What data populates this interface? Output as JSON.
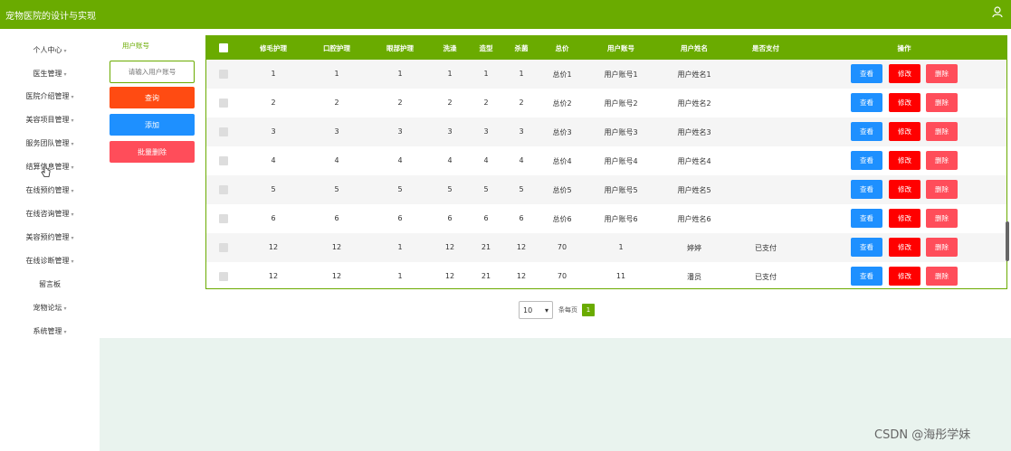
{
  "app": {
    "title": "宠物医院的设计与实现"
  },
  "sidebar": {
    "items": [
      {
        "label": "个人中心"
      },
      {
        "label": "医生管理"
      },
      {
        "label": "医院介绍管理"
      },
      {
        "label": "美容项目管理"
      },
      {
        "label": "服务团队管理"
      },
      {
        "label": "结算信息管理"
      },
      {
        "label": "在线预约管理"
      },
      {
        "label": "在线咨询管理"
      },
      {
        "label": "美容预约管理"
      },
      {
        "label": "在线诊断管理"
      },
      {
        "label": "留言板"
      },
      {
        "label": "宠物论坛"
      },
      {
        "label": "系统管理"
      }
    ]
  },
  "search": {
    "label": "用户账号",
    "placeholder": "请输入用户账号",
    "query_label": "查询",
    "add_label": "添加",
    "batch_delete_label": "批量删除"
  },
  "table": {
    "columns": [
      "修毛护理",
      "口腔护理",
      "眼部护理",
      "洗澡",
      "造型",
      "杀菌",
      "总价",
      "用户账号",
      "用户姓名",
      "是否支付",
      "操作"
    ],
    "rows": [
      {
        "cells": [
          "1",
          "1",
          "1",
          "1",
          "1",
          "1",
          "总价1",
          "用户账号1",
          "用户姓名1",
          ""
        ]
      },
      {
        "cells": [
          "2",
          "2",
          "2",
          "2",
          "2",
          "2",
          "总价2",
          "用户账号2",
          "用户姓名2",
          ""
        ]
      },
      {
        "cells": [
          "3",
          "3",
          "3",
          "3",
          "3",
          "3",
          "总价3",
          "用户账号3",
          "用户姓名3",
          ""
        ]
      },
      {
        "cells": [
          "4",
          "4",
          "4",
          "4",
          "4",
          "4",
          "总价4",
          "用户账号4",
          "用户姓名4",
          ""
        ]
      },
      {
        "cells": [
          "5",
          "5",
          "5",
          "5",
          "5",
          "5",
          "总价5",
          "用户账号5",
          "用户姓名5",
          ""
        ]
      },
      {
        "cells": [
          "6",
          "6",
          "6",
          "6",
          "6",
          "6",
          "总价6",
          "用户账号6",
          "用户姓名6",
          ""
        ]
      },
      {
        "cells": [
          "12",
          "12",
          "1",
          "12",
          "21",
          "12",
          "70",
          "1",
          "婷婷",
          "已支付"
        ]
      },
      {
        "cells": [
          "12",
          "12",
          "1",
          "12",
          "21",
          "12",
          "70",
          "11",
          "潘员",
          "已支付"
        ]
      }
    ],
    "actions": {
      "view": "查看",
      "edit": "修改",
      "delete": "删除"
    }
  },
  "pagination": {
    "page_size": "10",
    "per_page_label": "条每页",
    "current_page": "1"
  },
  "watermark": "CSDN @海彤学妹",
  "colors": {
    "brand": "#6aab00",
    "blue": "#1e90ff",
    "red": "#ff0000",
    "orange": "#ff4b12",
    "pink": "#ff4d5a"
  }
}
